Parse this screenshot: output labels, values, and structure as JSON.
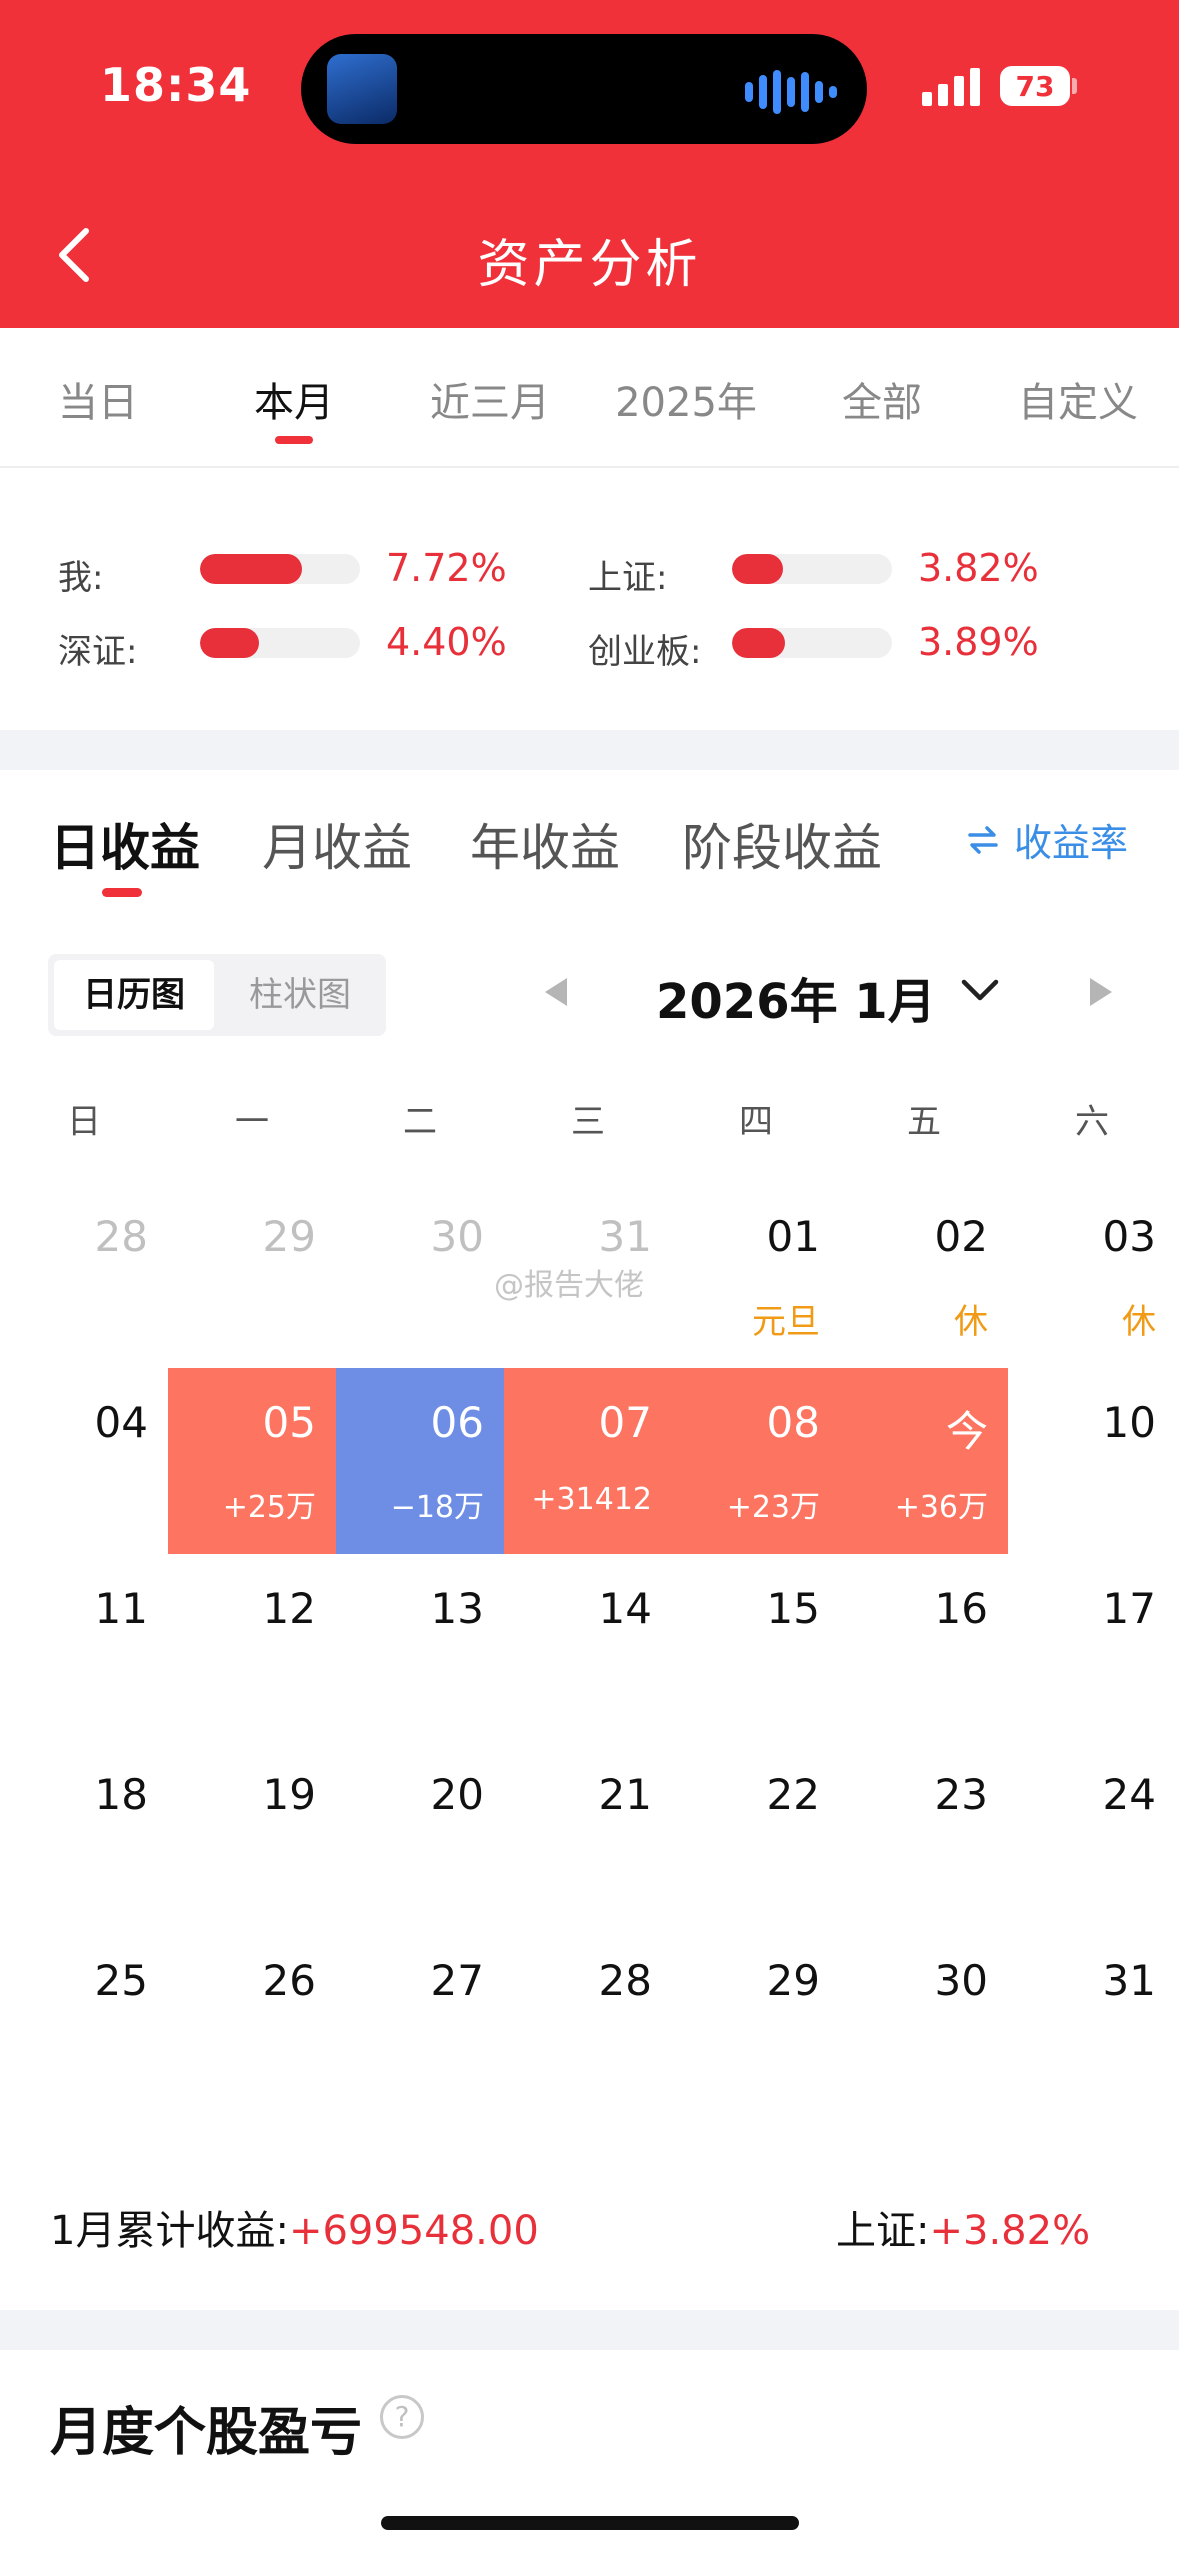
{
  "status_bar": {
    "time": "18:34",
    "battery": "73"
  },
  "header": {
    "title": "资产分析"
  },
  "period_tabs": [
    {
      "label": "当日",
      "active": false
    },
    {
      "label": "本月",
      "active": true
    },
    {
      "label": "近三月",
      "active": false
    },
    {
      "label": "2025年",
      "active": false
    },
    {
      "label": "全部",
      "active": false
    },
    {
      "label": "自定义",
      "active": false
    }
  ],
  "comparison": [
    {
      "label": "我:",
      "value": "7.72%",
      "fill_percent": 64
    },
    {
      "label": "上证:",
      "value": "3.82%",
      "fill_percent": 32
    },
    {
      "label": "深证:",
      "value": "4.40%",
      "fill_percent": 37
    },
    {
      "label": "创业板:",
      "value": "3.89%",
      "fill_percent": 33
    }
  ],
  "profit_tabs": [
    {
      "label": "日收益",
      "active": true
    },
    {
      "label": "月收益",
      "active": false
    },
    {
      "label": "年收益",
      "active": false
    },
    {
      "label": "阶段收益",
      "active": false
    }
  ],
  "rate_switch": {
    "label": "收益率",
    "icon": "swap-arrows-icon"
  },
  "view_toggle": {
    "calendar": "日历图",
    "bar": "柱状图",
    "active": "calendar"
  },
  "month_nav": {
    "title": "2026年 1月"
  },
  "weekdays": [
    "日",
    "一",
    "二",
    "三",
    "四",
    "五",
    "六"
  ],
  "calendar": [
    [
      {
        "day": "28",
        "outside": true
      },
      {
        "day": "29",
        "outside": true
      },
      {
        "day": "30",
        "outside": true
      },
      {
        "day": "31",
        "outside": true
      },
      {
        "day": "01",
        "sub": "元旦"
      },
      {
        "day": "02",
        "sub": "休"
      },
      {
        "day": "03",
        "sub": "休"
      }
    ],
    [
      {
        "day": "04"
      },
      {
        "day": "05",
        "sub": "+25万",
        "status": "gain"
      },
      {
        "day": "06",
        "sub": "−18万",
        "status": "loss"
      },
      {
        "day": "07",
        "sub": "+31412",
        "status": "gain"
      },
      {
        "day": "08",
        "sub": "+23万",
        "status": "gain"
      },
      {
        "day": "今",
        "sub": "+36万",
        "status": "gain"
      },
      {
        "day": "10"
      }
    ],
    [
      {
        "day": "11"
      },
      {
        "day": "12"
      },
      {
        "day": "13"
      },
      {
        "day": "14"
      },
      {
        "day": "15"
      },
      {
        "day": "16"
      },
      {
        "day": "17"
      }
    ],
    [
      {
        "day": "18"
      },
      {
        "day": "19"
      },
      {
        "day": "20"
      },
      {
        "day": "21"
      },
      {
        "day": "22"
      },
      {
        "day": "23"
      },
      {
        "day": "24"
      }
    ],
    [
      {
        "day": "25"
      },
      {
        "day": "26"
      },
      {
        "day": "27"
      },
      {
        "day": "28"
      },
      {
        "day": "29"
      },
      {
        "day": "30"
      },
      {
        "day": "31"
      }
    ]
  ],
  "watermark": "@报告大佬",
  "summary": {
    "month_label": "1月累计收益:",
    "month_value": "+699548.00",
    "index_label": "上证:",
    "index_value": "+3.82%"
  },
  "section": {
    "title": "月度个股盈亏",
    "help_icon": "question-circle-icon"
  },
  "colors": {
    "brand_red": "#f0313a",
    "gain": "#fd7461",
    "loss": "#6e8ee6",
    "holiday": "#f09a15",
    "link_blue": "#3a8ee6"
  }
}
